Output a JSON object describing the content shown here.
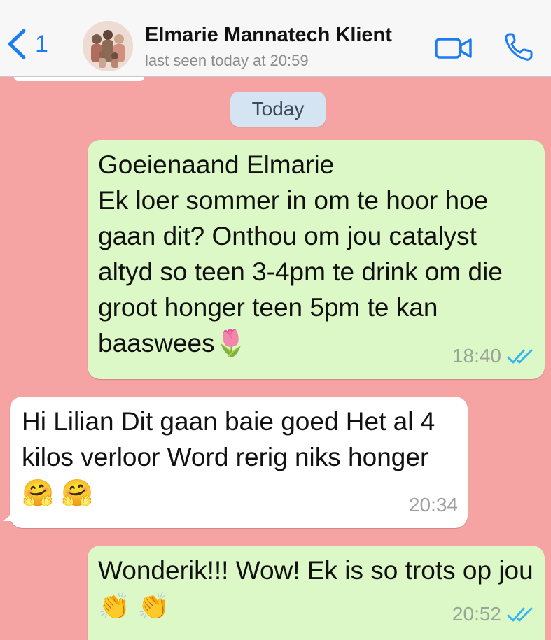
{
  "header": {
    "back_count": "1",
    "contact_name": "Elmarie Mannatech Klient",
    "status": "last seen today at 20:59"
  },
  "day_separator": "Today",
  "messages": [
    {
      "direction": "outgoing",
      "text": "Goeienaand Elmarie\nEk loer sommer in om te hoor hoe gaan dit? Onthou om jou catalyst altyd so teen 3-4pm te drink om die groot honger teen 5pm te kan baaswees🌷",
      "time": "18:40",
      "read": true
    },
    {
      "direction": "incoming",
      "text": "Hi Lilian Dit gaan baie goed Het al 4 kilos verloor Word rerig niks honger🤗 🤗",
      "time": "20:34"
    },
    {
      "direction": "outgoing",
      "text": "Wonderik!!! Wow! Ek is so trots op jou👏 👏",
      "time": "20:52",
      "read": true
    }
  ],
  "colors": {
    "chat_background": "#f5a3a3",
    "outgoing_bubble": "#dcf8c6",
    "incoming_bubble": "#ffffff",
    "accent": "#1e7cf2",
    "read_ticks": "#34b7f1"
  },
  "icons": {
    "back": "chevron-left-icon",
    "video": "video-camera-icon",
    "call": "phone-icon",
    "read_receipt": "double-check-icon"
  }
}
